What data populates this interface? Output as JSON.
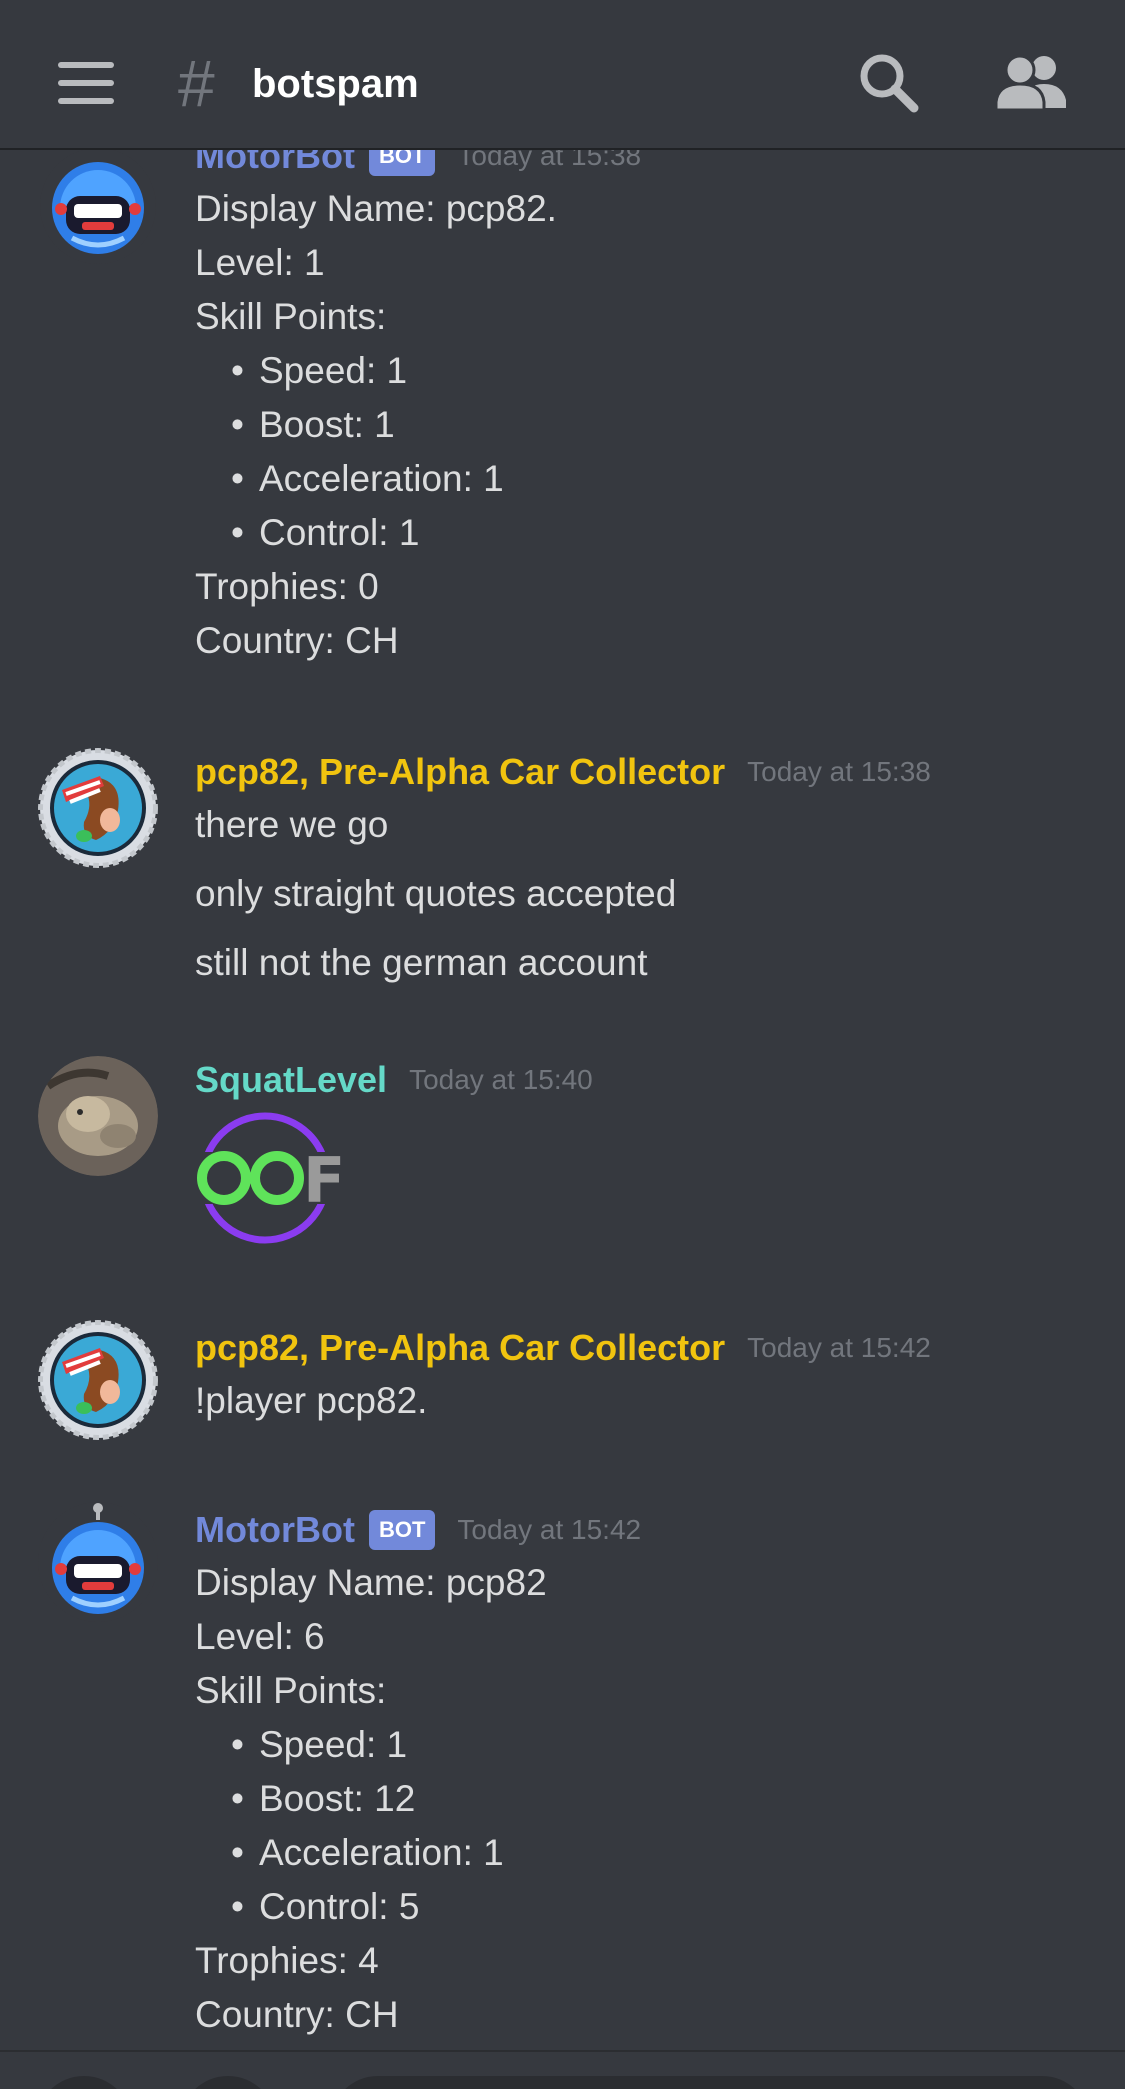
{
  "header": {
    "hash": "#",
    "channel": "botspam"
  },
  "messages": [
    {
      "author": "MotorBot",
      "badge": "BOT",
      "time": "Today at 15:38",
      "lines": [
        "Display Name: pcp82.",
        "Level: 1",
        "Skill Points:"
      ],
      "bullets": [
        "Speed: 1",
        "Boost: 1",
        "Acceleration: 1",
        "Control: 1"
      ],
      "tail": [
        "Trophies: 0",
        "Country: CH"
      ]
    },
    {
      "author": "pcp82, Pre-Alpha Car Collector",
      "time": "Today at 15:38",
      "lines": [
        "there we go",
        "only straight quotes accepted",
        "still not the german account"
      ]
    },
    {
      "author": "SquatLevel",
      "time": "Today at 15:40",
      "emoji": "OOF"
    },
    {
      "author": "pcp82, Pre-Alpha Car Collector",
      "time": "Today at 15:42",
      "lines": [
        "!player pcp82."
      ]
    },
    {
      "author": "MotorBot",
      "badge": "BOT",
      "time": "Today at 15:42",
      "lines": [
        "Display Name: pcp82",
        "Level: 6",
        "Skill Points:"
      ],
      "bullets": [
        "Speed: 1",
        "Boost: 12",
        "Acceleration: 1",
        "Control: 5"
      ],
      "tail": [
        "Trophies: 4",
        "Country: CH"
      ]
    }
  ],
  "colors": {
    "background": "#36393f",
    "bot_name": "#7289da",
    "pcp_name": "#f1c40f",
    "squat_name": "#65d9c8",
    "timestamp": "#72767d",
    "text": "#dcddde"
  }
}
